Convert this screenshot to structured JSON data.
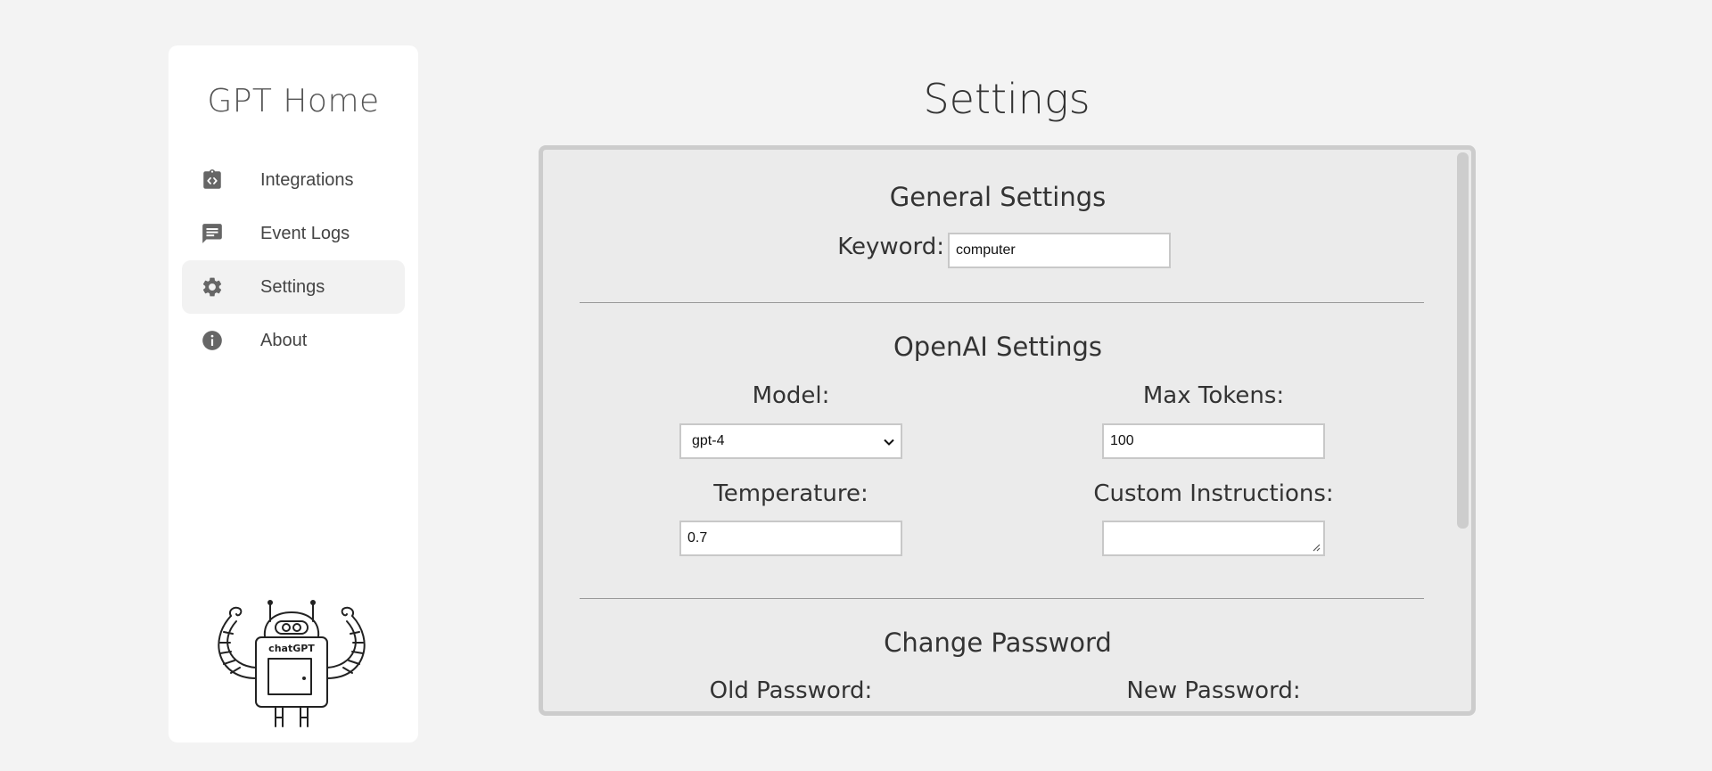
{
  "app": {
    "title": "GPT Home"
  },
  "sidebar": {
    "items": [
      {
        "label": "Integrations",
        "icon": "integrations-icon",
        "active": false
      },
      {
        "label": "Event Logs",
        "icon": "chat-bubble-icon",
        "active": false
      },
      {
        "label": "Settings",
        "icon": "gear-icon",
        "active": true
      },
      {
        "label": "About",
        "icon": "info-icon",
        "active": false
      }
    ],
    "mascot": {
      "text": "chatGPT",
      "icon": "robot-mascot-illustration"
    }
  },
  "page": {
    "title": "Settings"
  },
  "general": {
    "title": "General Settings",
    "keyword_label": "Keyword:",
    "keyword_value": "computer"
  },
  "openai": {
    "title": "OpenAI Settings",
    "model_label": "Model:",
    "model_value": "gpt-4",
    "max_tokens_label": "Max Tokens:",
    "max_tokens_value": "100",
    "temperature_label": "Temperature:",
    "temperature_value": "0.7",
    "custom_instructions_label": "Custom Instructions:",
    "custom_instructions_value": ""
  },
  "password": {
    "title": "Change Password",
    "old_label": "Old Password:",
    "new_label": "New Password:"
  },
  "colors": {
    "background": "#f3f3f3",
    "sidebar": "#ffffff",
    "panel": "#ebebeb",
    "icon": "#666666"
  }
}
